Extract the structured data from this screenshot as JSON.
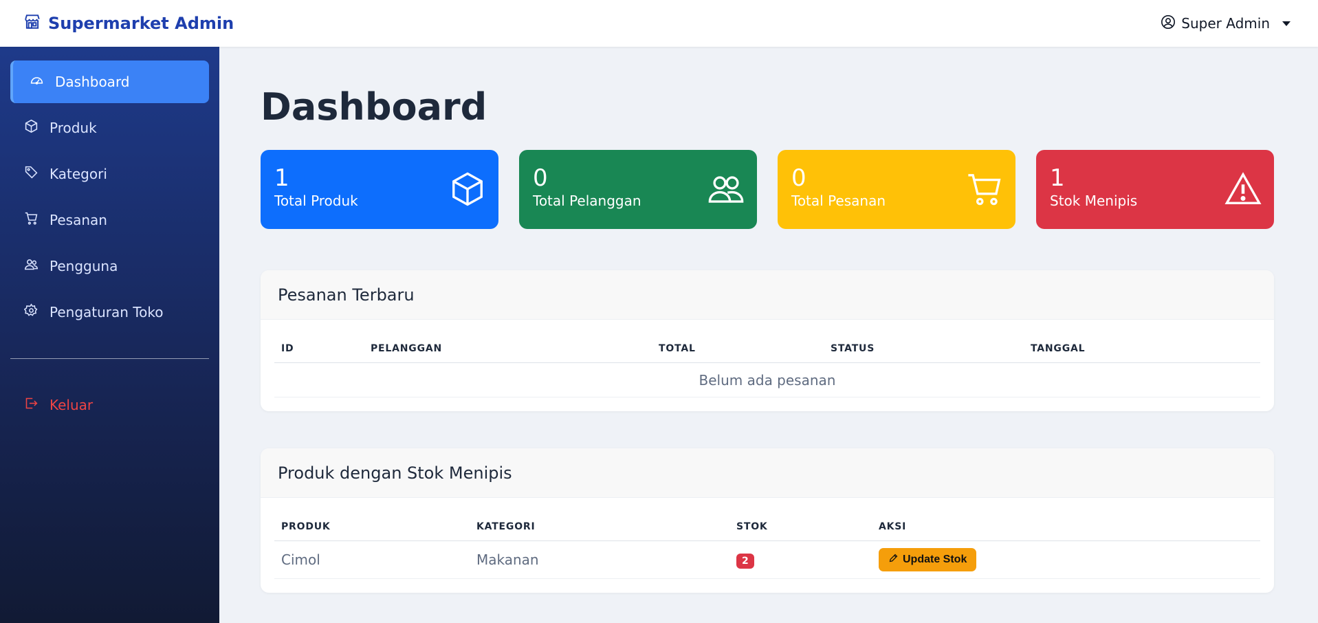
{
  "navbar": {
    "brand": "Supermarket Admin",
    "user": "Super Admin"
  },
  "sidebar": {
    "items": [
      {
        "label": "Dashboard",
        "icon": "speedometer-icon",
        "active": true
      },
      {
        "label": "Produk",
        "icon": "box-icon"
      },
      {
        "label": "Kategori",
        "icon": "tags-icon"
      },
      {
        "label": "Pesanan",
        "icon": "cart-icon"
      },
      {
        "label": "Pengguna",
        "icon": "people-icon"
      },
      {
        "label": "Pengaturan Toko",
        "icon": "gear-icon"
      }
    ],
    "logout": "Keluar"
  },
  "main": {
    "title": "Dashboard",
    "stats": [
      {
        "value": "1",
        "label": "Total Produk",
        "color": "#0d6efd",
        "icon": "box-icon"
      },
      {
        "value": "0",
        "label": "Total Pelanggan",
        "color": "#198754",
        "icon": "people-icon"
      },
      {
        "value": "0",
        "label": "Total Pesanan",
        "color": "#ffc107",
        "icon": "cart-icon"
      },
      {
        "value": "1",
        "label": "Stok Menipis",
        "color": "#dc3545",
        "icon": "warning-icon"
      }
    ],
    "orders": {
      "title": "Pesanan Terbaru",
      "columns": [
        "ID",
        "PELANGGAN",
        "TOTAL",
        "STATUS",
        "TANGGAL"
      ],
      "empty": "Belum ada pesanan"
    },
    "low_stock": {
      "title": "Produk dengan Stok Menipis",
      "columns": [
        "PRODUK",
        "KATEGORI",
        "STOK",
        "AKSI"
      ],
      "rows": [
        {
          "product": "Cimol",
          "category": "Makanan",
          "stock": "2",
          "action": "Update Stok"
        }
      ]
    }
  }
}
